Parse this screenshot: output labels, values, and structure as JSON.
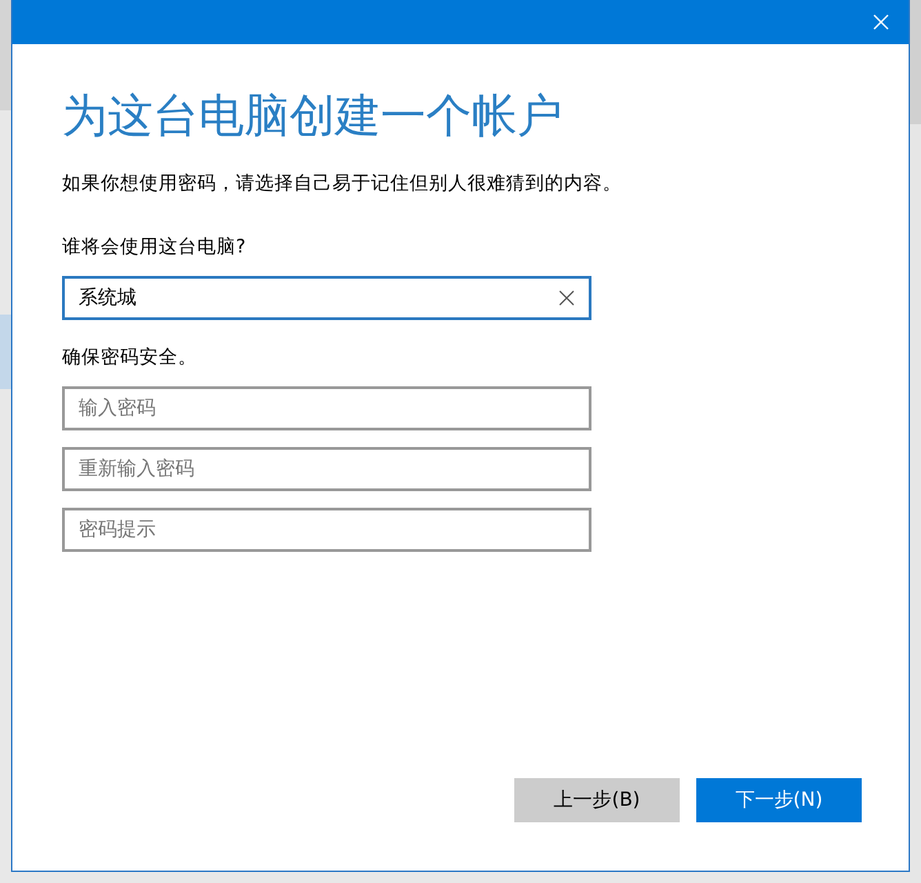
{
  "dialog": {
    "heading": "为这台电脑创建一个帐户",
    "description": "如果你想使用密码，请选择自己易于记住但别人很难猜到的内容。",
    "name_label": "谁将会使用这台电脑?",
    "name_field": {
      "value": "系统城",
      "focused": true
    },
    "password_label": "确保密码安全。",
    "password_fields": [
      {
        "placeholder": "输入密码"
      },
      {
        "placeholder": "重新输入密码"
      },
      {
        "placeholder": "密码提示"
      }
    ],
    "buttons": [
      {
        "label": "上一步(B)",
        "kind": "secondary"
      },
      {
        "label": "下一步(N)",
        "kind": "primary"
      }
    ]
  }
}
